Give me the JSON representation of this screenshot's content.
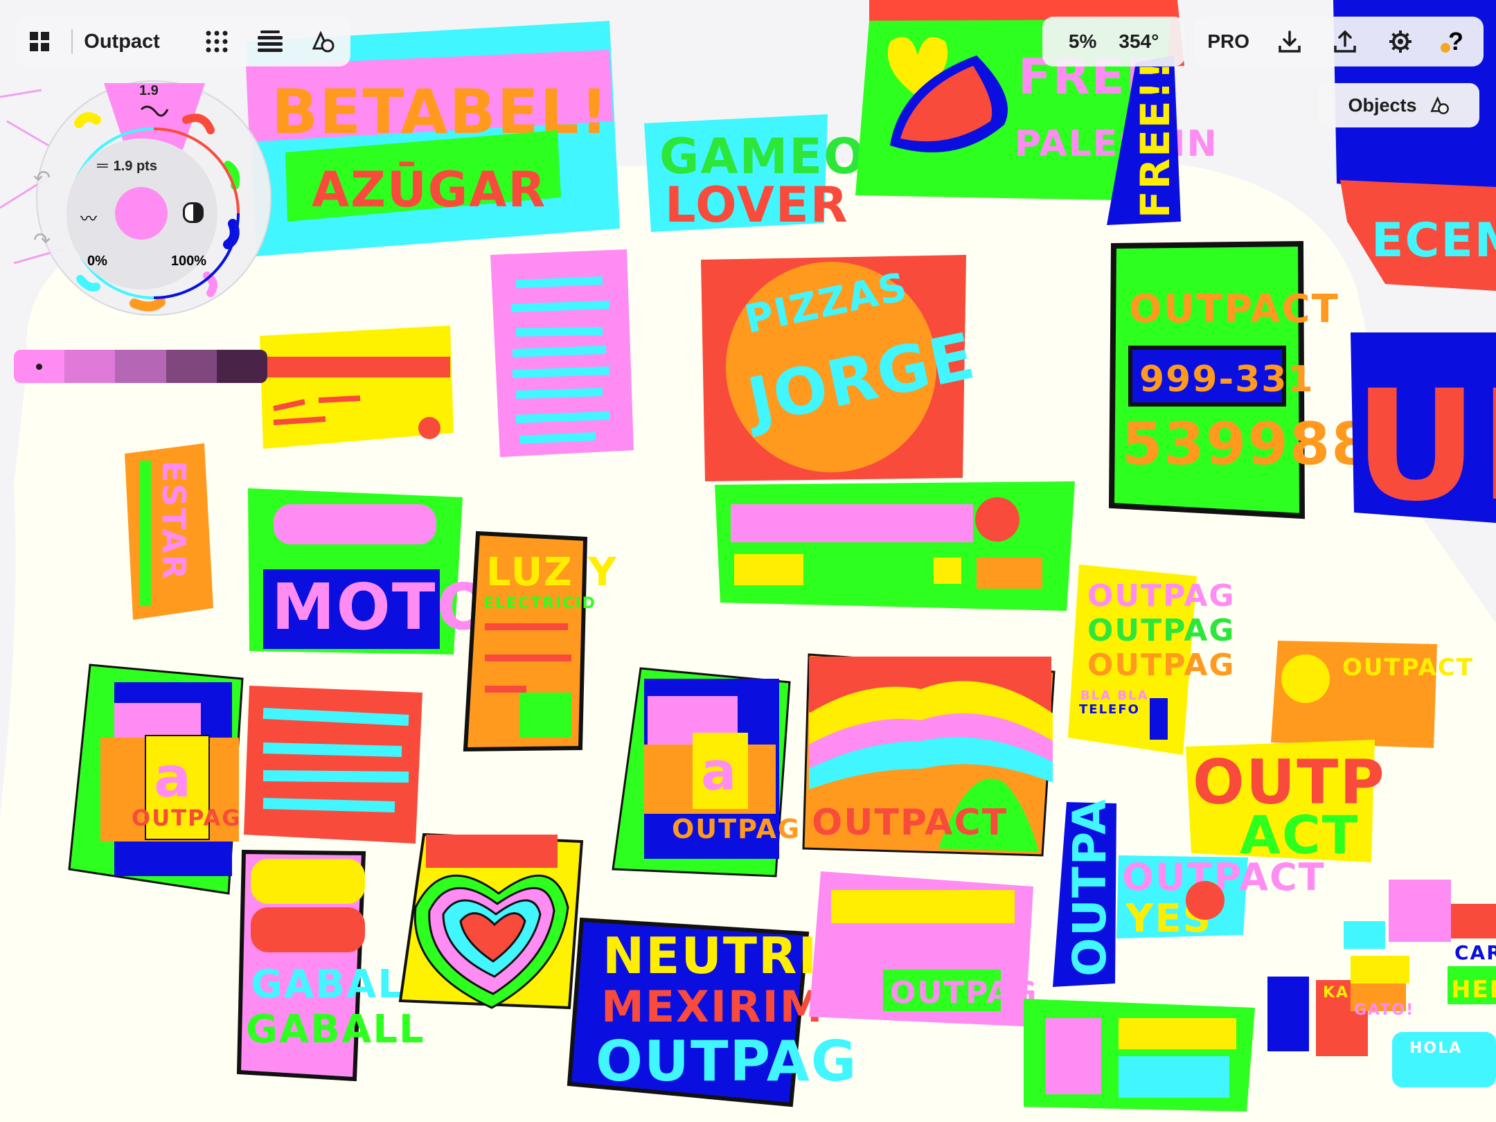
{
  "app": {
    "document_title": "Outpact"
  },
  "toolbar_left": {
    "gallery_icon": "grid-2x2-icon",
    "layers_icon": "dots-grid-icon",
    "menu_icon": "stacked-lines-icon",
    "shapes_icon": "shapes-icon"
  },
  "toolbar_right": {
    "zoom": "5%",
    "rotation": "354°",
    "pro_label": "PRO",
    "download_icon": "download-icon",
    "share_icon": "share-icon",
    "settings_icon": "gear-icon",
    "help_icon": "question-icon"
  },
  "objects_button": {
    "label": "Objects",
    "icon": "shapes-icon"
  },
  "brush_wheel": {
    "brush_size": "1.9",
    "stroke_size": "1.9 pts",
    "smoothing": "0%",
    "opacity": "100%",
    "current_color": "#ff8cf3"
  },
  "color_swatches": [
    "#ff8cf3",
    "#e07ad8",
    "#b566b5",
    "#80477f",
    "#4a2448"
  ],
  "canvas_text": {
    "betabel": "BETABEL!",
    "azugar": "AZŪGAR",
    "gameo": "GAMEO",
    "lover": "LOVER",
    "free": "FREE",
    "palestina": "PALESTIN",
    "free_vertical": "FREE!!",
    "ecemen": "ECEMEN",
    "pizzas": "PIZZAS",
    "jorge": "JORGE",
    "outpact_card": "OUTPACT",
    "phone_1": "999-331",
    "phone_2": "539988",
    "un": "UN",
    "estar": "ESTAR",
    "moto": "MOTO",
    "luz_y": "LUZ Y",
    "electricidad": "ELECTRICID",
    "outpag_1": "OUTPAG",
    "outpag_2": "OUTPAG",
    "outpag_3": "OUTPAG",
    "bla_bla": "BLA BLA",
    "telefo": "TELEFO",
    "a_letter": "a",
    "outpag_small": "OUTPAG",
    "outpact_wave": "OUTPACT",
    "outpact_small": "OUTPACT",
    "outp": "OUTP",
    "act": "ACT",
    "outpa_vertical": "OUTPA",
    "outpact_yes": "OUTPACT",
    "yes": "YES",
    "gaball_1": "GABALL",
    "gaball_2": "GABALL",
    "neutrin": "NEUTRIN",
    "mexirim": "MEXIRIM",
    "outpag_blue": "OUTPAG",
    "outpag_pink": "OUTPAG",
    "karate": "KARA TE",
    "gato": "GATO!",
    "car": "CAR",
    "hel": "HEL",
    "hola": "HOLA"
  }
}
